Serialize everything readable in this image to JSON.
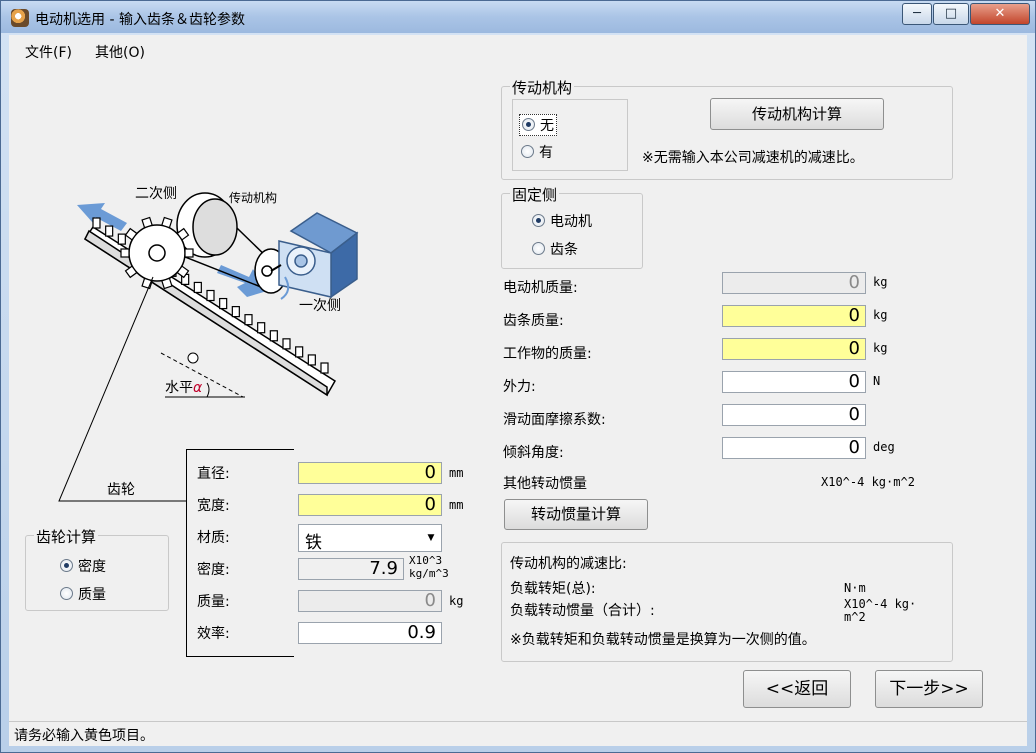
{
  "window": {
    "title": "电动机选用 - 输入齿条＆齿轮参数",
    "minimize": "─",
    "restore": "□",
    "close": "✕"
  },
  "menu": {
    "file": "文件(F)",
    "other": "其他(O)"
  },
  "diagram": {
    "secondary_side": "二次侧",
    "transmission": "传动机构",
    "primary_side": "一次侧",
    "horizontal": "水平",
    "alpha": "α",
    "gear": "齿轮"
  },
  "gear_params": {
    "diameter_label": "直径:",
    "diameter_value": "0",
    "diameter_unit": "mm",
    "width_label": "宽度:",
    "width_value": "0",
    "width_unit": "mm",
    "material_label": "材质:",
    "material_value": "铁",
    "density_label": "密度:",
    "density_value": "7.9",
    "density_unit_1": "X10^3",
    "density_unit_2": "kg/m^3",
    "mass_label": "质量:",
    "mass_value": "0",
    "mass_unit": "kg",
    "efficiency_label": "效率:",
    "efficiency_value": "0.9"
  },
  "gear_calc": {
    "legend": "齿轮计算",
    "option_density": "密度",
    "option_mass": "质量",
    "selected": "density"
  },
  "transmission": {
    "legend": "传动机构",
    "option_none": "无",
    "option_yes": "有",
    "selected": "none",
    "calc_button": "传动机构计算",
    "note": "※无需输入本公司减速机的减速比。"
  },
  "fixed_side": {
    "legend": "固定侧",
    "option_motor": "电动机",
    "option_rack": "齿条",
    "selected": "motor"
  },
  "params": {
    "motor_mass_label": "电动机质量:",
    "motor_mass_value": "0",
    "motor_mass_unit": "kg",
    "rack_mass_label": "齿条质量:",
    "rack_mass_value": "0",
    "rack_mass_unit": "kg",
    "work_mass_label": "工作物的质量:",
    "work_mass_value": "0",
    "work_mass_unit": "kg",
    "external_force_label": "外力:",
    "external_force_value": "0",
    "external_force_unit": "N",
    "friction_label": "滑动面摩擦系数:",
    "friction_value": "0",
    "angle_label": "倾斜角度:",
    "angle_value": "0",
    "angle_unit": "deg",
    "other_inertia_label": "其他转动惯量",
    "other_inertia_unit": "X10^-4 kg·m^2",
    "inertia_calc_button": "转动惯量计算"
  },
  "results": {
    "ratio_label": "传动机构的减速比:",
    "torque_label": "负载转矩(总):",
    "torque_unit": "N·m",
    "inertia_label": "负载转动惯量（合计）:",
    "inertia_unit_1": "X10^-4 kg·",
    "inertia_unit_2": "m^2",
    "note": "※负载转矩和负载转动惯量是换算为一次侧的值。"
  },
  "nav": {
    "back": "<<返回",
    "next": "下一步>>"
  },
  "status": {
    "text": "请务必输入黄色项目。"
  }
}
